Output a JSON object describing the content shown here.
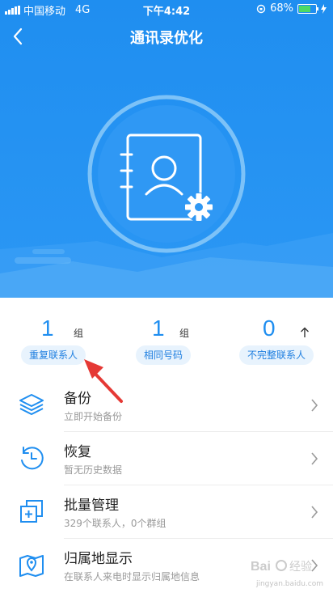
{
  "status_bar": {
    "carrier": "中国移动",
    "network": "4G",
    "time": "下午4:42",
    "battery_percent": "68%",
    "battery_level": 0.68
  },
  "nav": {
    "title": "通讯录优化",
    "back_icon": "chevron-left-icon"
  },
  "hero": {
    "illustration_icon": "contact-book-settings-icon"
  },
  "stats": [
    {
      "count": "1",
      "unit": "组",
      "label": "重复联系人"
    },
    {
      "count": "1",
      "unit": "组",
      "label": "相同号码"
    },
    {
      "count": "0",
      "unit": "",
      "label": "不完整联系人",
      "trend_icon": "arrow-up-icon"
    }
  ],
  "menu": [
    {
      "title": "备份",
      "subtitle": "立即开始备份",
      "icon": "layers-icon"
    },
    {
      "title": "恢复",
      "subtitle": "暂无历史数据",
      "icon": "history-clock-icon"
    },
    {
      "title": "批量管理",
      "subtitle": "329个联系人，0个群组",
      "icon": "batch-copy-icon"
    },
    {
      "title": "归属地显示",
      "subtitle": "在联系人来电时显示归属地信息",
      "icon": "map-location-icon"
    }
  ],
  "colors": {
    "brand_blue": "#1f8ef0",
    "pill_bg": "#e8f3fd",
    "annotation_red": "#e53935"
  },
  "watermark": {
    "text": "jingyan.baidu.com"
  }
}
